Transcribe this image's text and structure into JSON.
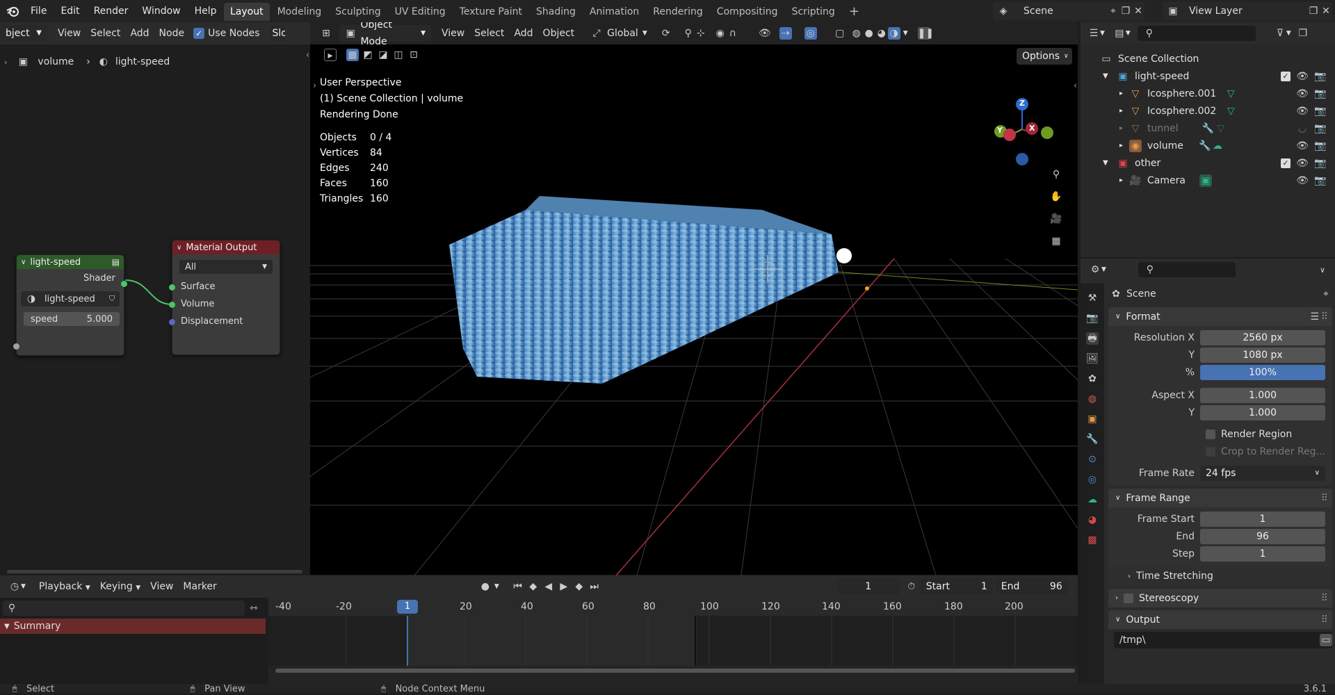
{
  "topbar": {
    "menus": [
      "File",
      "Edit",
      "Render",
      "Window",
      "Help"
    ],
    "workspaces": [
      "Layout",
      "Modeling",
      "Sculpting",
      "UV Editing",
      "Texture Paint",
      "Shading",
      "Animation",
      "Rendering",
      "Compositing",
      "Scripting"
    ],
    "active_workspace": "Layout",
    "add_tab": "+",
    "scene_label": "Scene",
    "view_layer_label": "View Layer"
  },
  "node_editor": {
    "header": {
      "type_label": "bject",
      "view": "View",
      "select": "Select",
      "add": "Add",
      "node": "Node",
      "use_nodes": "Use Nodes",
      "slot": "Slo"
    },
    "breadcrumb": {
      "object": "volume",
      "material": "light-speed"
    },
    "group_node": {
      "title": "light-speed",
      "output": "Shader",
      "material_name": "light-speed",
      "input_label": "speed",
      "input_value": "5.000"
    },
    "output_node": {
      "title": "Material Output",
      "target": "All",
      "inputs": [
        "Surface",
        "Volume",
        "Displacement"
      ]
    }
  },
  "viewport": {
    "header": {
      "mode": "Object Mode",
      "view": "View",
      "select": "Select",
      "add": "Add",
      "object": "Object",
      "orientation": "Global",
      "options": "Options"
    },
    "overlay": {
      "line1": "User Perspective",
      "line2": "(1) Scene Collection | volume",
      "line3": "Rendering Done"
    },
    "stats": [
      [
        "Objects",
        "0 / 4"
      ],
      [
        "Vertices",
        "84"
      ],
      [
        "Edges",
        "240"
      ],
      [
        "Faces",
        "160"
      ],
      [
        "Triangles",
        "160"
      ]
    ],
    "gizmo": {
      "z": "Z",
      "y": "Y",
      "x": "X"
    }
  },
  "outliner": {
    "root": "Scene Collection",
    "items": [
      {
        "label": "light-speed",
        "kind": "collection"
      },
      {
        "label": "Icosphere.001",
        "kind": "object"
      },
      {
        "label": "Icosphere.002",
        "kind": "object"
      },
      {
        "label": "tunnel",
        "kind": "object"
      },
      {
        "label": "volume",
        "kind": "object"
      },
      {
        "label": "other",
        "kind": "collection"
      },
      {
        "label": "Camera",
        "kind": "object"
      }
    ]
  },
  "properties": {
    "context": "Scene",
    "format": {
      "title": "Format",
      "res_x_label": "Resolution X",
      "res_x": "2560 px",
      "res_y_label": "Y",
      "res_y": "1080 px",
      "pct_label": "%",
      "pct": "100%",
      "aspect_x_label": "Aspect X",
      "aspect_x": "1.000",
      "aspect_y_label": "Y",
      "aspect_y": "1.000",
      "render_region": "Render Region",
      "crop": "Crop to Render Reg...",
      "frame_rate_label": "Frame Rate",
      "frame_rate": "24 fps"
    },
    "frame_range": {
      "title": "Frame Range",
      "start_label": "Frame Start",
      "start": "1",
      "end_label": "End",
      "end": "96",
      "step_label": "Step",
      "step": "1"
    },
    "time_stretching": "Time Stretching",
    "stereoscopy": "Stereoscopy",
    "output": {
      "title": "Output",
      "path": "/tmp\\"
    }
  },
  "timeline": {
    "menus": [
      "Playback",
      "Keying",
      "View",
      "Marker"
    ],
    "current_frame": "1",
    "start_label": "Start",
    "start": "1",
    "end_label": "End",
    "end": "96",
    "ticks": [
      "-40",
      "-20",
      "1",
      "20",
      "40",
      "60",
      "80",
      "100",
      "120",
      "140",
      "160",
      "180",
      "200"
    ],
    "summary": "Summary"
  },
  "statusbar": {
    "select": "Select",
    "pan": "Pan View",
    "context": "Node Context Menu",
    "version": "3.6.1"
  }
}
